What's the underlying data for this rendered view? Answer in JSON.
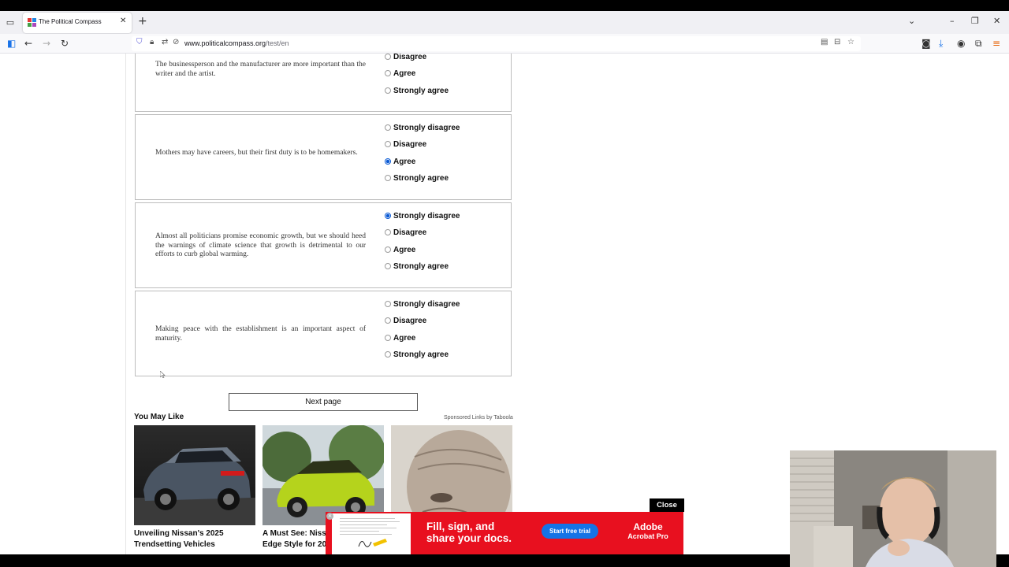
{
  "browser": {
    "tab_title": "The Political Compass",
    "url_domain": "www.politicalcompass.org",
    "url_path": "/test/en",
    "icons": {
      "tab_list": "tab-list-icon",
      "close_tab": "close-icon",
      "new_tab": "plus-icon",
      "back": "back-arrow-icon",
      "forward": "forward-arrow-icon",
      "reload": "reload-icon",
      "shield": "shield-icon",
      "lock": "lock-icon",
      "reader": "reader-view-icon",
      "bookmark": "star-icon",
      "screenshot": "camera-icon",
      "download": "download-icon",
      "account": "account-icon",
      "extensions": "extensions-icon",
      "menu": "hamburger-menu-icon"
    }
  },
  "questions": [
    {
      "text": "The businessperson and the manufacturer are more important than the writer and the artist.",
      "options": [
        {
          "label": "Disagree",
          "checked": false
        },
        {
          "label": "Agree",
          "checked": false
        },
        {
          "label": "Strongly agree",
          "checked": false
        }
      ]
    },
    {
      "text": "Mothers may have careers, but their first duty is to be homemakers.",
      "options": [
        {
          "label": "Strongly disagree",
          "checked": false
        },
        {
          "label": "Disagree",
          "checked": false
        },
        {
          "label": "Agree",
          "checked": true
        },
        {
          "label": "Strongly agree",
          "checked": false
        }
      ]
    },
    {
      "text": "Almost all politicians promise economic growth, but we should heed the warnings of climate science that growth is detrimental to our efforts to curb global warming.",
      "options": [
        {
          "label": "Strongly disagree",
          "checked": true
        },
        {
          "label": "Disagree",
          "checked": false
        },
        {
          "label": "Agree",
          "checked": false
        },
        {
          "label": "Strongly agree",
          "checked": false
        }
      ]
    },
    {
      "text": "Making peace with the establishment is an important aspect of maturity.",
      "options": [
        {
          "label": "Strongly disagree",
          "checked": false
        },
        {
          "label": "Disagree",
          "checked": false
        },
        {
          "label": "Agree",
          "checked": false
        },
        {
          "label": "Strongly agree",
          "checked": false
        }
      ]
    }
  ],
  "next_button": "Next page",
  "recommendations": {
    "heading": "You May Like",
    "sponsored": "Sponsored Links by Taboola",
    "cards": [
      {
        "caption": [
          "Unveiling Nissan's 2025",
          "Trendsetting Vehicles"
        ]
      },
      {
        "caption": [
          "A Must See: Niss",
          "Edge Style for 20"
        ]
      },
      {
        "caption": [
          "",
          ""
        ]
      }
    ]
  },
  "ad": {
    "close_label": "Close",
    "headline": [
      "Fill, sign, and",
      "share your docs."
    ],
    "cta": "Start free trial",
    "brand": [
      "Adobe",
      "Acrobat Pro"
    ],
    "colors": {
      "background": "#e8101f",
      "cta": "#1473e6"
    }
  }
}
